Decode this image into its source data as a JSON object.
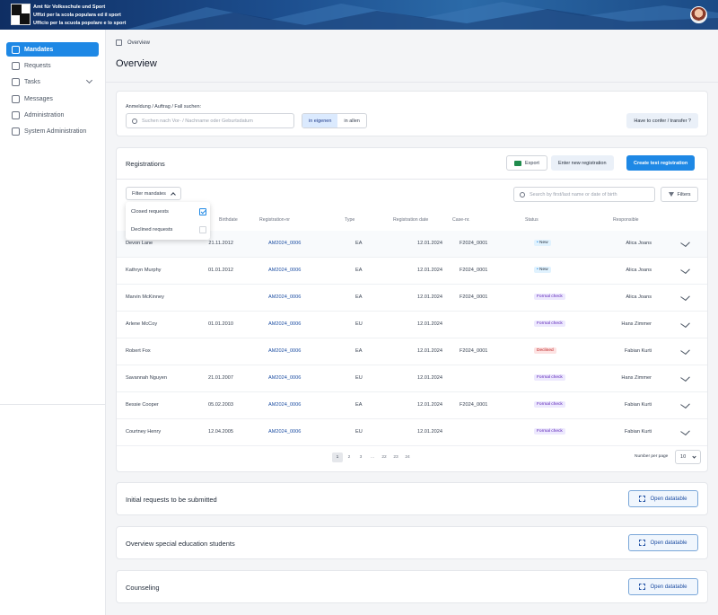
{
  "header": {
    "org_lines": [
      "Amt für Volksschule und Sport",
      "Uffizi per la scola populara ed il sport",
      "Ufficio per la scuola popolare e lo sport"
    ]
  },
  "sidebar": {
    "items": [
      {
        "label": "Mandates",
        "icon": "chart-icon",
        "active": true
      },
      {
        "label": "Requests",
        "icon": "edit-icon"
      },
      {
        "label": "Tasks",
        "icon": "tasks-icon",
        "has_children": true
      },
      {
        "label": "Messages",
        "icon": "message-icon"
      },
      {
        "label": "Administration",
        "icon": "user-icon"
      },
      {
        "label": "System Administration",
        "icon": "building-icon"
      }
    ]
  },
  "breadcrumb": {
    "current": "Overview"
  },
  "page": {
    "title": "Overview"
  },
  "search": {
    "label": "Anmeldung / Auftrag / Fall suchen:",
    "placeholder": "Suchen nach Vor- / Nachname oder Geburtsdatum",
    "scope_options": [
      "in eigenen",
      "in allen"
    ],
    "scope_selected": "in eigenen",
    "confer_button": "Have to confer / transfer ?"
  },
  "registrations": {
    "title": "Registrations",
    "export_label": "Export",
    "enter_label": "Enter new registration",
    "create_label": "Create test registration",
    "filter_label": "Filter mandates",
    "search_placeholder": "Search by first/last name or date of birth",
    "filters_label": "Filters",
    "dropdown": [
      {
        "label": "Closed requests",
        "checked": true
      },
      {
        "label": "Declined requests",
        "checked": false
      }
    ],
    "columns": [
      "Birthdate",
      "Registration-nr",
      "Type",
      "Registration date",
      "Case-nr.",
      "Status",
      "Responsible"
    ],
    "rows": [
      {
        "name": "Devon Lane",
        "birthdate": "21.11.2012",
        "reg_nr": "AM2024_0006",
        "type": "EA",
        "reg_date": "12.01.2024",
        "case_nr": "F2024_0001",
        "status": "New",
        "status_kind": "new",
        "responsible": "Alica Joans"
      },
      {
        "name": "Kathryn Murphy",
        "birthdate": "01.01.2012",
        "reg_nr": "AM2024_0006",
        "type": "EA",
        "reg_date": "12.01.2024",
        "case_nr": "F2024_0001",
        "status": "New",
        "status_kind": "new",
        "responsible": "Alica Joans"
      },
      {
        "name": "Marvin McKinney",
        "birthdate": "",
        "reg_nr": "AM2024_0006",
        "type": "EA",
        "reg_date": "12.01.2024",
        "case_nr": "F2024_0001",
        "status": "Formal check",
        "status_kind": "formal",
        "responsible": "Alica Joans"
      },
      {
        "name": "Arlene McCoy",
        "birthdate": "01.01.2010",
        "reg_nr": "AM2024_0006",
        "type": "EU",
        "reg_date": "12.01.2024",
        "case_nr": "",
        "status": "Formal check",
        "status_kind": "formal",
        "responsible": "Hans Zimmer"
      },
      {
        "name": "Robert Fox",
        "birthdate": "",
        "reg_nr": "AM2024_0006",
        "type": "EA",
        "reg_date": "12.01.2024",
        "case_nr": "F2024_0001",
        "status": "Declined",
        "status_kind": "declined",
        "responsible": "Fabian Kurti"
      },
      {
        "name": "Savannah Nguyen",
        "birthdate": "21.01.2007",
        "reg_nr": "AM2024_0006",
        "type": "EU",
        "reg_date": "12.01.2024",
        "case_nr": "",
        "status": "Formal check",
        "status_kind": "formal",
        "responsible": "Hans Zimmer"
      },
      {
        "name": "Bessie Cooper",
        "birthdate": "05.02.2003",
        "reg_nr": "AM2024_0006",
        "type": "EA",
        "reg_date": "12.01.2024",
        "case_nr": "F2024_0001",
        "status": "Formal check",
        "status_kind": "formal",
        "responsible": "Fabian Kurti"
      },
      {
        "name": "Courtney Henry",
        "birthdate": "12.04.2005",
        "reg_nr": "AM2024_0006",
        "type": "EU",
        "reg_date": "12.01.2024",
        "case_nr": "",
        "status": "Formal check",
        "status_kind": "formal",
        "responsible": "Fabian Kurti"
      }
    ],
    "pagination": {
      "pages": [
        "1",
        "2",
        "3",
        "...",
        "22",
        "23",
        "24"
      ],
      "current": "1"
    },
    "per_page_label": "Number per page",
    "per_page_value": "10"
  },
  "sections": [
    {
      "title": "Initial requests to be submitted",
      "button": "Open datatable"
    },
    {
      "title": "Overview special education students",
      "button": "Open datatable"
    },
    {
      "title": "Counseling",
      "button": "Open datatable"
    }
  ],
  "colors": {
    "accent": "#1e88e5",
    "link": "#1e4fa3",
    "header": "#1d4f8f"
  }
}
